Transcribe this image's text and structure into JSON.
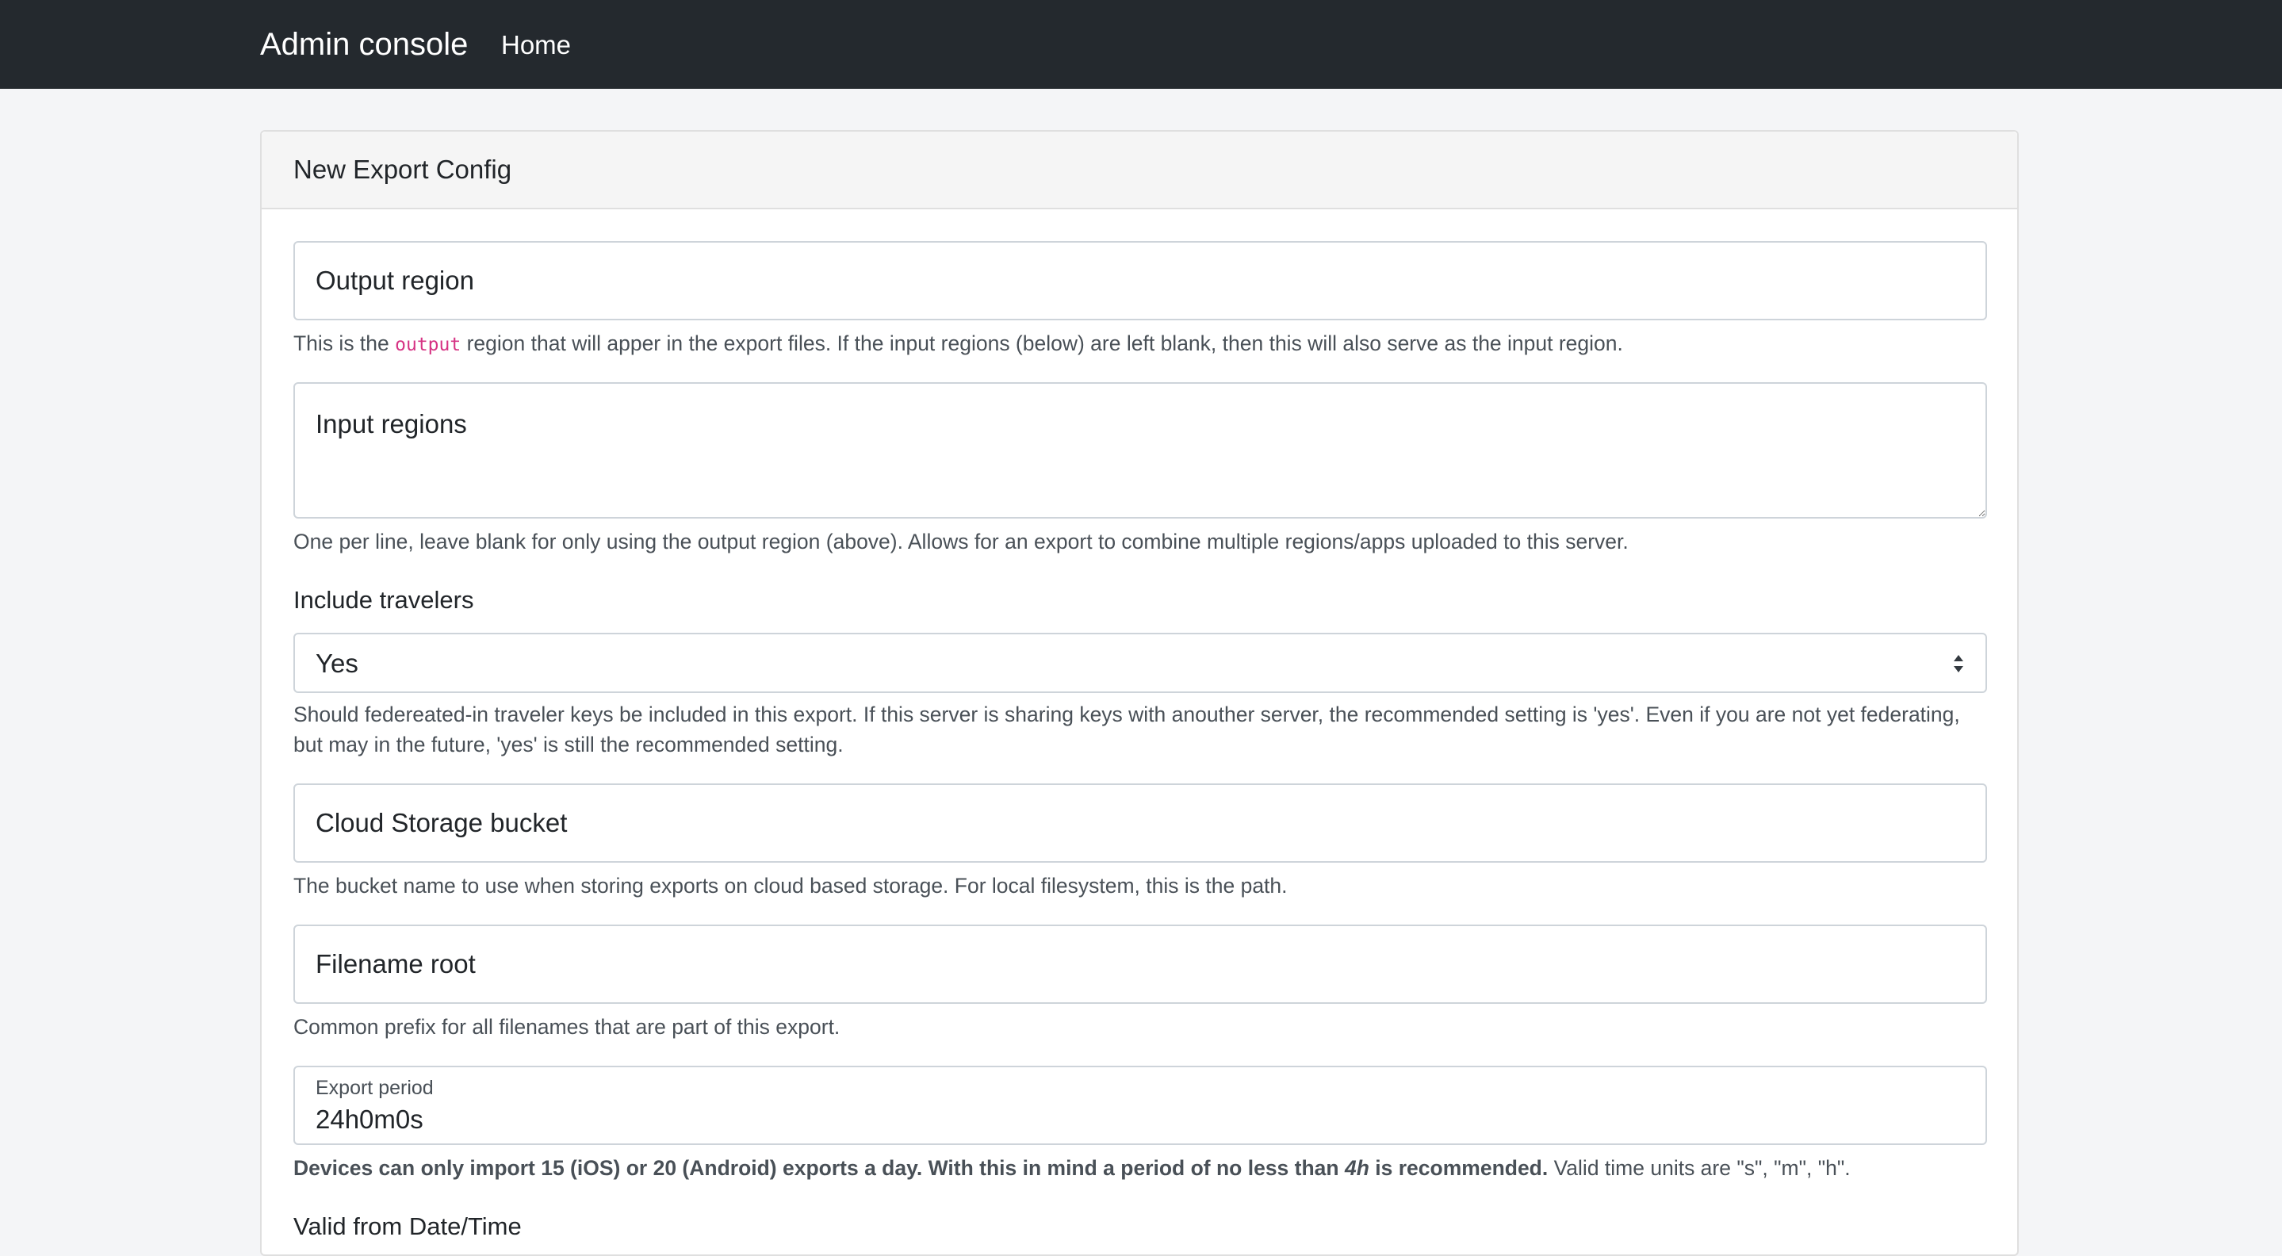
{
  "navbar": {
    "brand": "Admin console",
    "home_link": "Home"
  },
  "card": {
    "title": "New Export Config"
  },
  "output_region": {
    "placeholder": "Output region",
    "value": "",
    "help_before": "This is the ",
    "help_code": "output",
    "help_after": " region that will apper in the export files. If the input regions (below) are left blank, then this will also serve as the input region."
  },
  "input_regions": {
    "placeholder": "Input regions",
    "value": "",
    "help": "One per line, leave blank for only using the output region (above). Allows for an export to combine multiple regions/apps uploaded to this server."
  },
  "include_travelers": {
    "label": "Include travelers",
    "selected": "Yes",
    "help": "Should federeated-in traveler keys be included in this export. If this server is sharing keys with anouther server, the recommended setting is 'yes'. Even if you are not yet federating, but may in the future, 'yes' is still the recommended setting."
  },
  "cloud_bucket": {
    "placeholder": "Cloud Storage bucket",
    "value": "",
    "help": "The bucket name to use when storing exports on cloud based storage. For local filesystem, this is the path."
  },
  "filename_root": {
    "placeholder": "Filename root",
    "value": "",
    "help": "Common prefix for all filenames that are part of this export."
  },
  "export_period": {
    "label": "Export period",
    "value": "24h0m0s",
    "help_bold_1": "Devices can only import 15 (iOS) or 20 (Android) exports a day. With this in mind a period of no less than ",
    "help_bold_italic": "4h",
    "help_bold_2": " is recommended.",
    "help_rest": " Valid time units are \"s\", \"m\", \"h\"."
  },
  "valid_from": {
    "label": "Valid from Date/Time"
  }
}
